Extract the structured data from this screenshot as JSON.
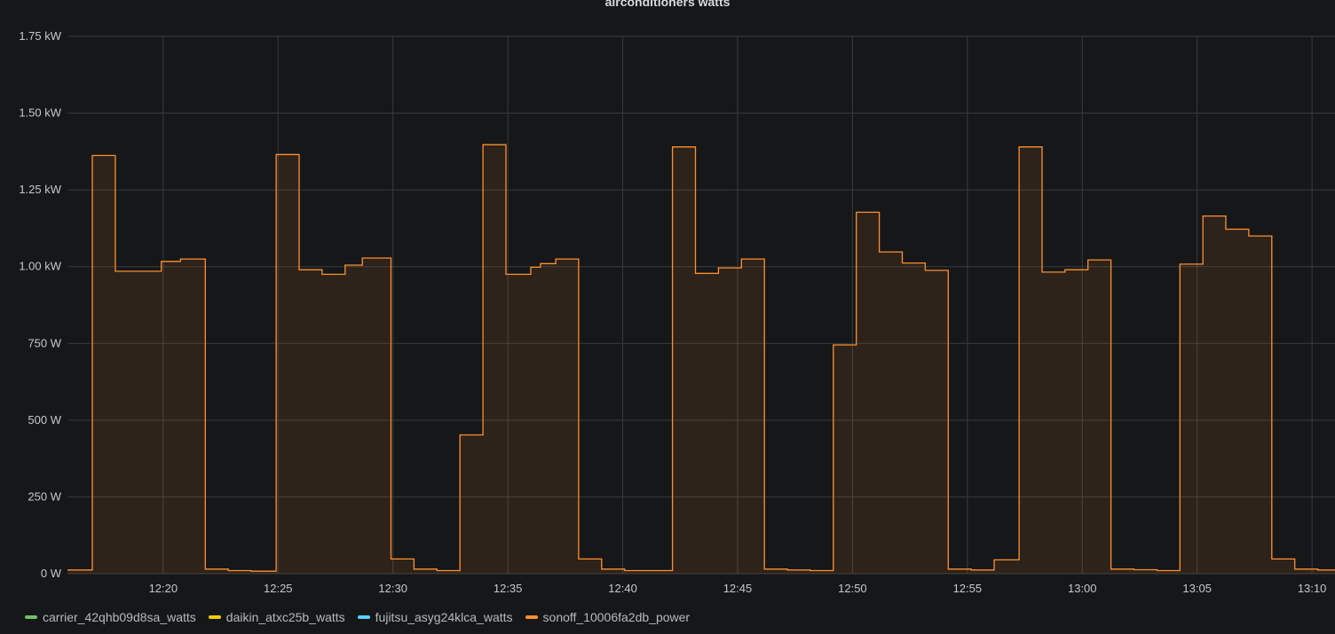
{
  "chart_data": {
    "type": "line",
    "title": "airconditioners watts",
    "xlabel": "",
    "ylabel": "",
    "step": true,
    "fill": true,
    "grid": true,
    "legend_position": "bottom-left",
    "x_range": [
      "12:15:50",
      "13:11:00"
    ],
    "ylim": [
      0,
      1750
    ],
    "y_ticks": [
      {
        "value": 0,
        "label": "0 W"
      },
      {
        "value": 250,
        "label": "250 W"
      },
      {
        "value": 500,
        "label": "500 W"
      },
      {
        "value": 750,
        "label": "750 W"
      },
      {
        "value": 1000,
        "label": "1.00 kW"
      },
      {
        "value": 1250,
        "label": "1.25 kW"
      },
      {
        "value": 1500,
        "label": "1.50 kW"
      },
      {
        "value": 1750,
        "label": "1.75 kW"
      }
    ],
    "x_ticks": [
      "12:20",
      "12:25",
      "12:30",
      "12:35",
      "12:40",
      "12:45",
      "12:50",
      "12:55",
      "13:00",
      "13:05",
      "13:10"
    ],
    "series": [
      {
        "name": "carrier_42qhb09d8sa_watts",
        "color": "#73bf69",
        "points": []
      },
      {
        "name": "daikin_atxc25b_watts",
        "color": "#f2cc0c",
        "points": []
      },
      {
        "name": "fujitsu_asyg24klca_watts",
        "color": "#5ad2ff",
        "points": []
      },
      {
        "name": "sonoff_10006fa2db_power",
        "color": "#ff8f2f",
        "points": [
          [
            "12:15:50",
            12
          ],
          [
            "12:16:55",
            1362
          ],
          [
            "12:17:55",
            985
          ],
          [
            "12:19:55",
            1017
          ],
          [
            "12:20:45",
            1025
          ],
          [
            "12:21:50",
            15
          ],
          [
            "12:22:50",
            10
          ],
          [
            "12:23:50",
            8
          ],
          [
            "12:24:55",
            1365
          ],
          [
            "12:25:55",
            990
          ],
          [
            "12:26:55",
            975
          ],
          [
            "12:27:55",
            1005
          ],
          [
            "12:28:40",
            1028
          ],
          [
            "12:29:55",
            48
          ],
          [
            "12:30:55",
            15
          ],
          [
            "12:31:55",
            10
          ],
          [
            "12:32:55",
            452
          ],
          [
            "12:33:55",
            1397
          ],
          [
            "12:34:55",
            975
          ],
          [
            "12:36:00",
            998
          ],
          [
            "12:36:25",
            1010
          ],
          [
            "12:37:05",
            1025
          ],
          [
            "12:38:05",
            48
          ],
          [
            "12:39:05",
            15
          ],
          [
            "12:40:05",
            10
          ],
          [
            "12:42:10",
            1390
          ],
          [
            "12:43:10",
            978
          ],
          [
            "12:44:10",
            996
          ],
          [
            "12:45:10",
            1025
          ],
          [
            "12:46:10",
            15
          ],
          [
            "12:47:10",
            12
          ],
          [
            "12:48:10",
            10
          ],
          [
            "12:49:10",
            745
          ],
          [
            "12:50:10",
            1177
          ],
          [
            "12:51:10",
            1048
          ],
          [
            "12:52:10",
            1012
          ],
          [
            "12:53:10",
            988
          ],
          [
            "12:54:10",
            15
          ],
          [
            "12:55:10",
            12
          ],
          [
            "12:56:10",
            45
          ],
          [
            "12:57:15",
            1390
          ],
          [
            "12:58:15",
            982
          ],
          [
            "12:59:15",
            990
          ],
          [
            "13:00:15",
            1022
          ],
          [
            "13:01:15",
            15
          ],
          [
            "13:02:15",
            13
          ],
          [
            "13:03:15",
            10
          ],
          [
            "13:04:15",
            1008
          ],
          [
            "13:05:15",
            1165
          ],
          [
            "13:06:15",
            1122
          ],
          [
            "13:07:15",
            1100
          ],
          [
            "13:08:15",
            48
          ],
          [
            "13:09:15",
            15
          ],
          [
            "13:10:15",
            12
          ],
          [
            "13:11:00",
            12
          ]
        ]
      }
    ]
  }
}
